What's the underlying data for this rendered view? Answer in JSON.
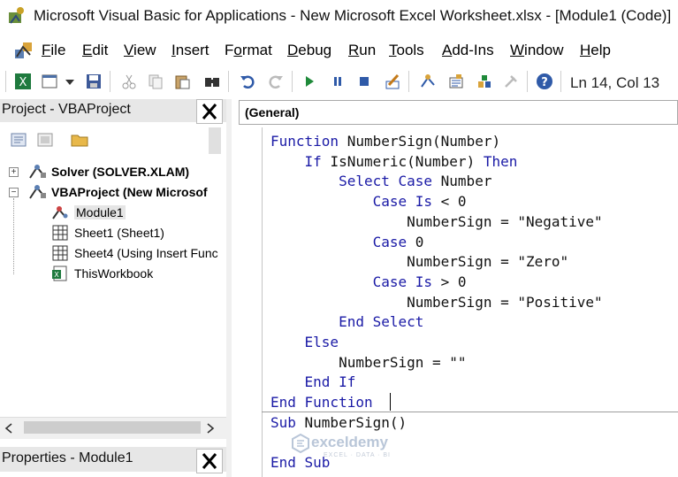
{
  "window": {
    "title": "Microsoft Visual Basic for Applications - New Microsoft Excel Worksheet.xlsx - [Module1 (Code)]"
  },
  "menu": [
    {
      "label": "File",
      "accel": "F",
      "rest": "ile"
    },
    {
      "label": "Edit",
      "accel": "E",
      "rest": "dit"
    },
    {
      "label": "View",
      "accel": "V",
      "rest": "iew"
    },
    {
      "label": "Insert",
      "accel": "I",
      "rest": "nsert"
    },
    {
      "label": "Format",
      "accel": "o",
      "pre": "F",
      "rest": "rmat"
    },
    {
      "label": "Debug",
      "accel": "D",
      "rest": "ebug"
    },
    {
      "label": "Run",
      "accel": "R",
      "rest": "un"
    },
    {
      "label": "Tools",
      "accel": "T",
      "rest": "ools"
    },
    {
      "label": "Add-Ins",
      "accel": "A",
      "rest": "dd-Ins"
    },
    {
      "label": "Window",
      "accel": "W",
      "rest": "indow"
    },
    {
      "label": "Help",
      "accel": "H",
      "rest": "elp"
    }
  ],
  "toolbar": {
    "cursor_position": "Ln 14, Col 13",
    "icons": [
      "excel-icon",
      "insert-userform-icon",
      "dropdown-icon",
      "save-icon",
      "cut-icon",
      "copy-icon",
      "paste-icon",
      "find-icon",
      "undo-icon",
      "redo-icon",
      "run-icon",
      "break-icon",
      "reset-icon",
      "design-mode-icon",
      "project-explorer-icon",
      "properties-icon",
      "object-browser-icon",
      "toolbox-icon",
      "help-icon"
    ]
  },
  "project_pane": {
    "title": "Project - VBAProject",
    "close_glyph": "✕",
    "tree": [
      {
        "label": "Solver (SOLVER.XLAM)",
        "level": 0,
        "bold": true,
        "expander": "+"
      },
      {
        "label": "VBAProject (New Microsof",
        "level": 0,
        "bold": true,
        "expander": "−"
      },
      {
        "label": "Module1",
        "level": 1,
        "bold": false
      },
      {
        "label": "Sheet1 (Sheet1)",
        "level": 1,
        "bold": false
      },
      {
        "label": "Sheet4 (Using Insert Func",
        "level": 1,
        "bold": false
      },
      {
        "label": "ThisWorkbook",
        "level": 1,
        "bold": false
      }
    ]
  },
  "properties_pane": {
    "title": "Properties - Module1",
    "close_glyph": "✕"
  },
  "code_window": {
    "object_combo": "(General)",
    "lines": [
      [
        {
          "t": "Function ",
          "k": true
        },
        {
          "t": "NumberSign(Number)",
          "k": false
        }
      ],
      [
        {
          "t": "    If ",
          "k": true
        },
        {
          "t": "IsNumeric(Number) ",
          "k": false
        },
        {
          "t": "Then",
          "k": true
        }
      ],
      [
        {
          "t": "        Select Case ",
          "k": true
        },
        {
          "t": "Number",
          "k": false
        }
      ],
      [
        {
          "t": "            Case Is ",
          "k": true
        },
        {
          "t": "< 0",
          "k": false
        }
      ],
      [
        {
          "t": "                NumberSign = \"Negative\"",
          "k": false
        }
      ],
      [
        {
          "t": "            Case ",
          "k": true
        },
        {
          "t": "0",
          "k": false
        }
      ],
      [
        {
          "t": "                NumberSign = \"Zero\"",
          "k": false
        }
      ],
      [
        {
          "t": "            Case Is ",
          "k": true
        },
        {
          "t": "> 0",
          "k": false
        }
      ],
      [
        {
          "t": "                NumberSign = \"Positive\"",
          "k": false
        }
      ],
      [
        {
          "t": "        End Select",
          "k": true
        }
      ],
      [
        {
          "t": "    Else",
          "k": true
        }
      ],
      [
        {
          "t": "        NumberSign = \"\"",
          "k": false
        }
      ],
      [
        {
          "t": "    End If",
          "k": true
        }
      ],
      [
        {
          "t": "End Function",
          "k": true
        }
      ],
      [
        {
          "t": "Sub ",
          "k": true
        },
        {
          "t": "NumberSign()",
          "k": false
        }
      ],
      [
        {
          "t": "",
          "k": false
        }
      ],
      [
        {
          "t": "End Sub",
          "k": true
        }
      ]
    ]
  },
  "watermark": {
    "text": "exceldemy",
    "sub": "EXCEL · DATA · BI"
  },
  "colors": {
    "keyword": "#1a1aa6",
    "pane_title_bg": "#e7e7e7"
  }
}
